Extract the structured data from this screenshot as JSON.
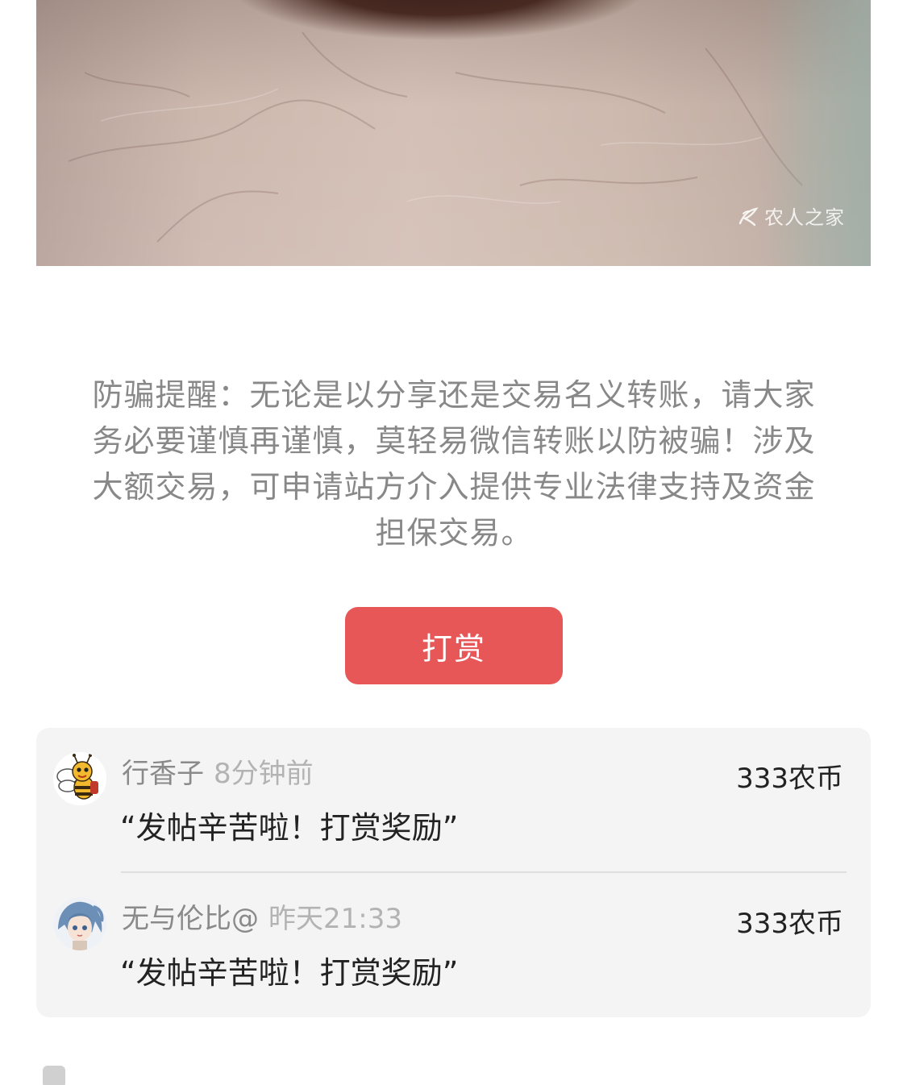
{
  "post_image": {
    "watermark_text": "农人之家",
    "watermark_icon": "farm-logo-icon"
  },
  "notice": {
    "text": "防骗提醒：无论是以分享还是交易名义转账，请大家务必要谨慎再谨慎，莫轻易微信转账以防被骗！涉及大额交易，可申请站方介入提供专业法律支持及资金担保交易。"
  },
  "reward_button": {
    "label": "打赏",
    "color": "#e85757"
  },
  "rewards": [
    {
      "user": "行香子",
      "time": "8分钟前",
      "amount": "333农币",
      "message": "“发帖辛苦啦！打赏奖励”",
      "avatar": "bee-avatar-icon"
    },
    {
      "user": "无与伦比@",
      "time": "昨天21:33",
      "amount": "333农币",
      "message": "“发帖辛苦啦！打赏奖励”",
      "avatar": "anime-girl-avatar-icon"
    }
  ],
  "colors": {
    "accent": "#e85757",
    "list_background": "#f4f4f4",
    "muted_text": "#888888"
  }
}
